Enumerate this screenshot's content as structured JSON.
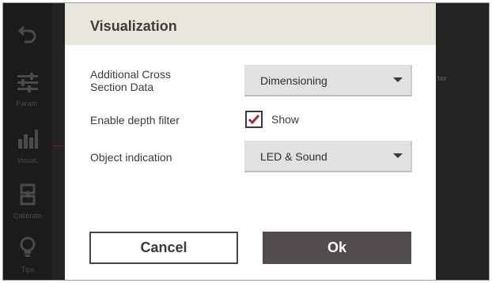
{
  "background": {
    "sidebar": [
      {
        "icon": "undo-icon",
        "label": ""
      },
      {
        "icon": "sliders-icon",
        "label": "Param."
      },
      {
        "icon": "bar-chart-icon",
        "label": "Visual."
      },
      {
        "icon": "calibrate-icon",
        "label": "Calibrate"
      },
      {
        "icon": "lightbulb-icon",
        "label": "Tips"
      }
    ],
    "right_text": "ter"
  },
  "dialog": {
    "title": "Visualization",
    "cross_section": {
      "label_line1": "Additional Cross",
      "label_line2": "Section Data",
      "value": "Dimensioning"
    },
    "depth_filter": {
      "label": "Enable depth filter",
      "checkbox_label": "Show",
      "checked": true
    },
    "object_indication": {
      "label": "Object indication",
      "value": "LED & Sound"
    },
    "buttons": {
      "cancel": "Cancel",
      "ok": "Ok"
    }
  },
  "colors": {
    "header_bg": "#e9e6dd",
    "ok_bg": "#524c4c",
    "check_mark": "#b0243a"
  }
}
